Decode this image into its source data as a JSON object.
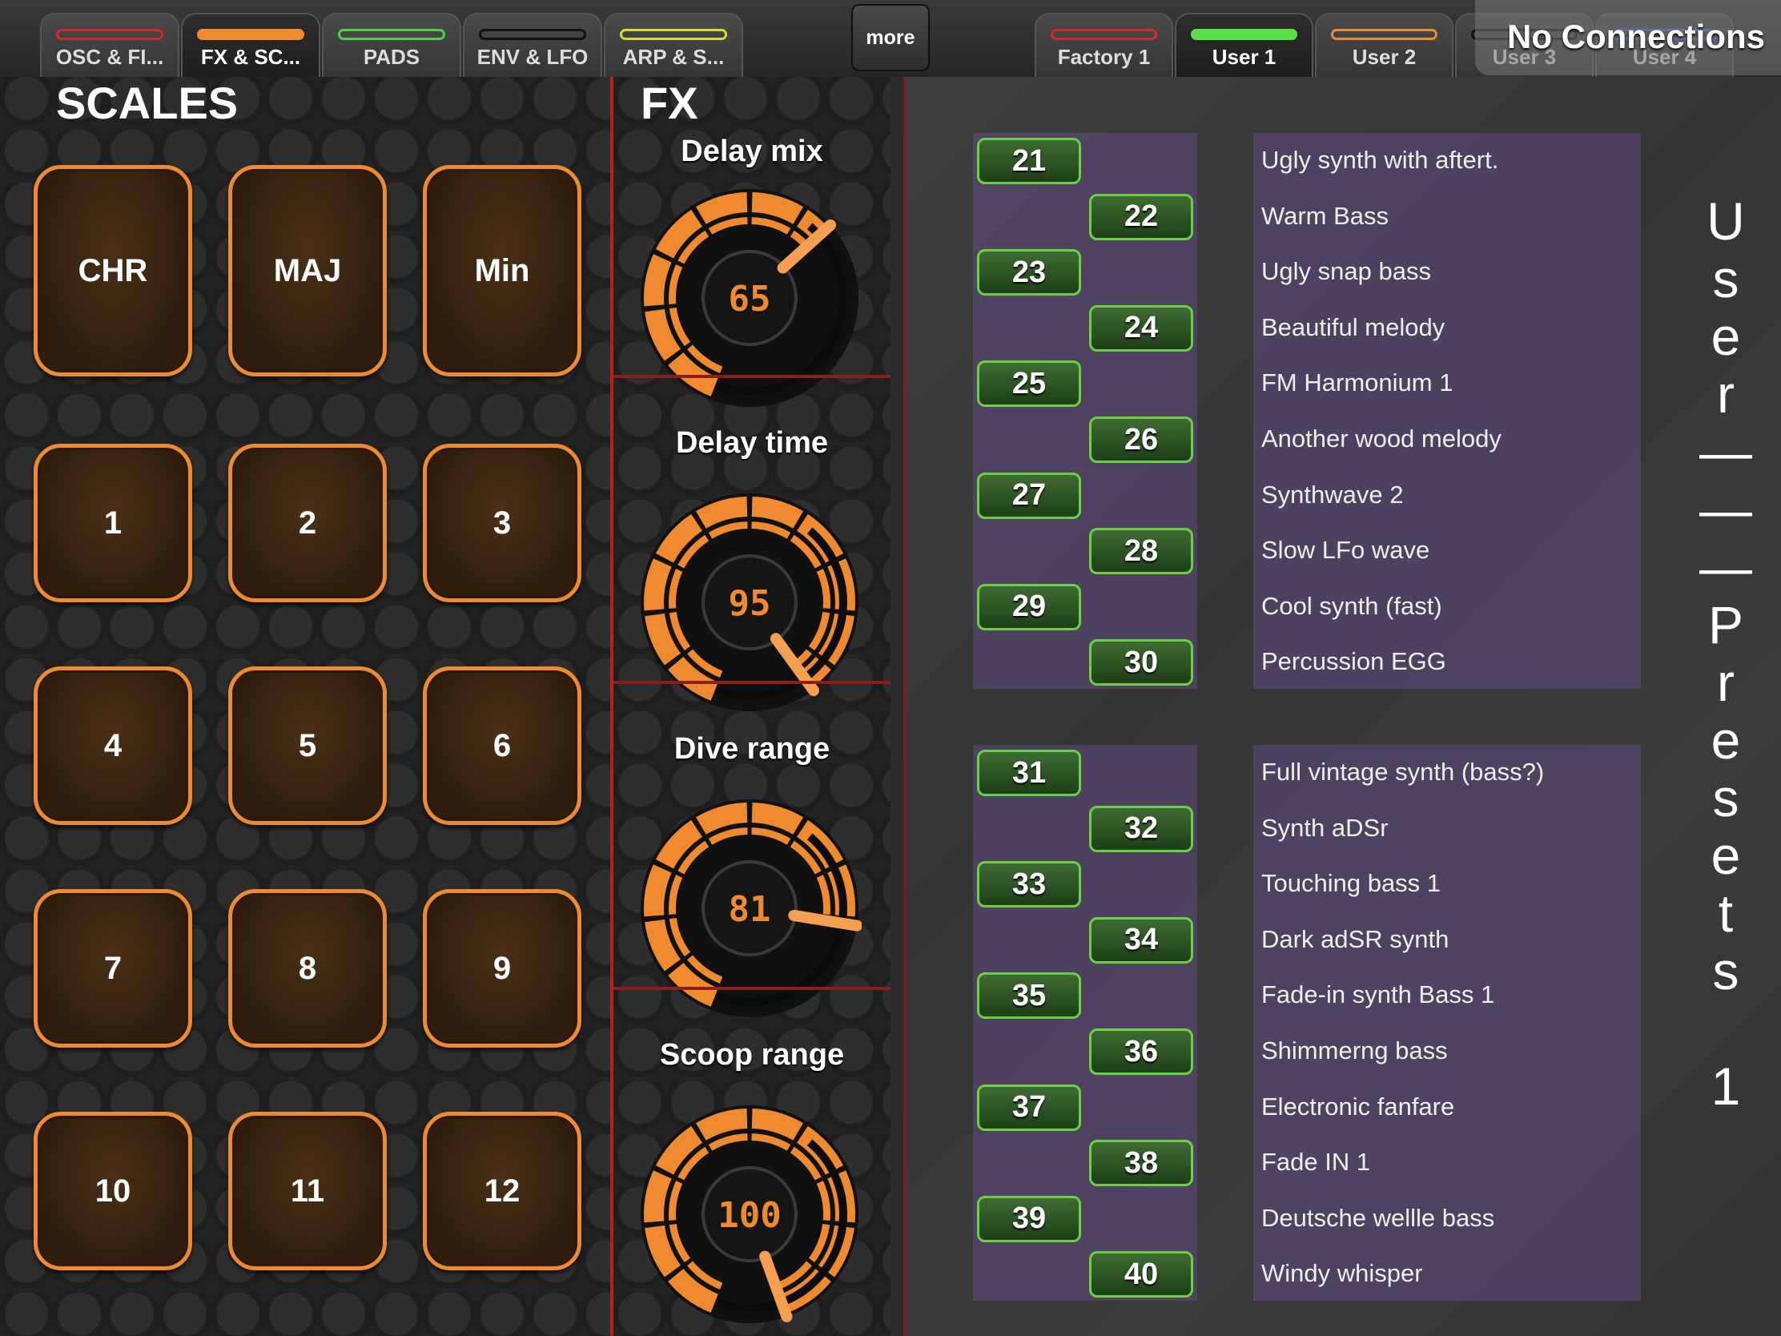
{
  "tabs": {
    "left": [
      {
        "label": "OSC & FI...",
        "color": "#d8262b",
        "active": false
      },
      {
        "label": "FX & SC...",
        "color": "#f08a30",
        "active": true
      },
      {
        "label": "PADS",
        "color": "#4fd04a",
        "active": false
      },
      {
        "label": "ENV & LFO",
        "color": "#111111",
        "active": false
      },
      {
        "label": "ARP & S...",
        "color": "#d9d931",
        "active": false
      }
    ],
    "more": "more",
    "right": [
      {
        "label": "Factory 1",
        "color": "#d8262b",
        "active": false
      },
      {
        "label": "User 1",
        "color": "#5ae04a",
        "active": true
      },
      {
        "label": "User 2",
        "color": "#f08a30",
        "active": false
      },
      {
        "label": "User 3",
        "color": "#111111",
        "active": false
      },
      {
        "label": "User 4",
        "color": "#3a6bd8",
        "active": false
      }
    ]
  },
  "connection_status": "No Connections",
  "scales": {
    "title": "SCALES",
    "buttons": [
      "CHR",
      "MAJ",
      "Min",
      "1",
      "2",
      "3",
      "4",
      "5",
      "6",
      "7",
      "8",
      "9",
      "10",
      "11",
      "12"
    ]
  },
  "fx": {
    "title": "FX",
    "knobs": [
      {
        "label": "Delay mix",
        "value": "65",
        "fraction": 0.65
      },
      {
        "label": "Delay time",
        "value": "95",
        "fraction": 0.95
      },
      {
        "label": "Dive  range",
        "value": "81",
        "fraction": 0.81
      },
      {
        "label": "Scoop range",
        "value": "100",
        "fraction": 1.0
      }
    ]
  },
  "presets": {
    "panel_title": "User___Presets 1",
    "groups": [
      {
        "items": [
          {
            "num": "21",
            "name": "Ugly synth with aftert."
          },
          {
            "num": "22",
            "name": "Warm Bass"
          },
          {
            "num": "23",
            "name": "Ugly snap bass"
          },
          {
            "num": "24",
            "name": "Beautiful melody"
          },
          {
            "num": "25",
            "name": "FM Harmonium 1"
          },
          {
            "num": "26",
            "name": "Another wood melody"
          },
          {
            "num": "27",
            "name": "Synthwave 2"
          },
          {
            "num": "28",
            "name": "Slow LFo wave"
          },
          {
            "num": "29",
            "name": "Cool synth (fast)"
          },
          {
            "num": "30",
            "name": "Percussion EGG"
          }
        ]
      },
      {
        "items": [
          {
            "num": "31",
            "name": "Full vintage synth (bass?)"
          },
          {
            "num": "32",
            "name": "Synth aDSr"
          },
          {
            "num": "33",
            "name": "Touching bass 1"
          },
          {
            "num": "34",
            "name": "Dark adSR synth"
          },
          {
            "num": "35",
            "name": "Fade-in synth Bass 1"
          },
          {
            "num": "36",
            "name": "Shimmerng  bass"
          },
          {
            "num": "37",
            "name": "Electronic fanfare"
          },
          {
            "num": "38",
            "name": "Fade IN 1"
          },
          {
            "num": "39",
            "name": "Deutsche wellle  bass"
          },
          {
            "num": "40",
            "name": "Windy whisper"
          }
        ]
      }
    ]
  },
  "colors": {
    "accent_orange": "#f08a30",
    "preset_green": "#6ad046",
    "divider_red": "#b3221f"
  }
}
